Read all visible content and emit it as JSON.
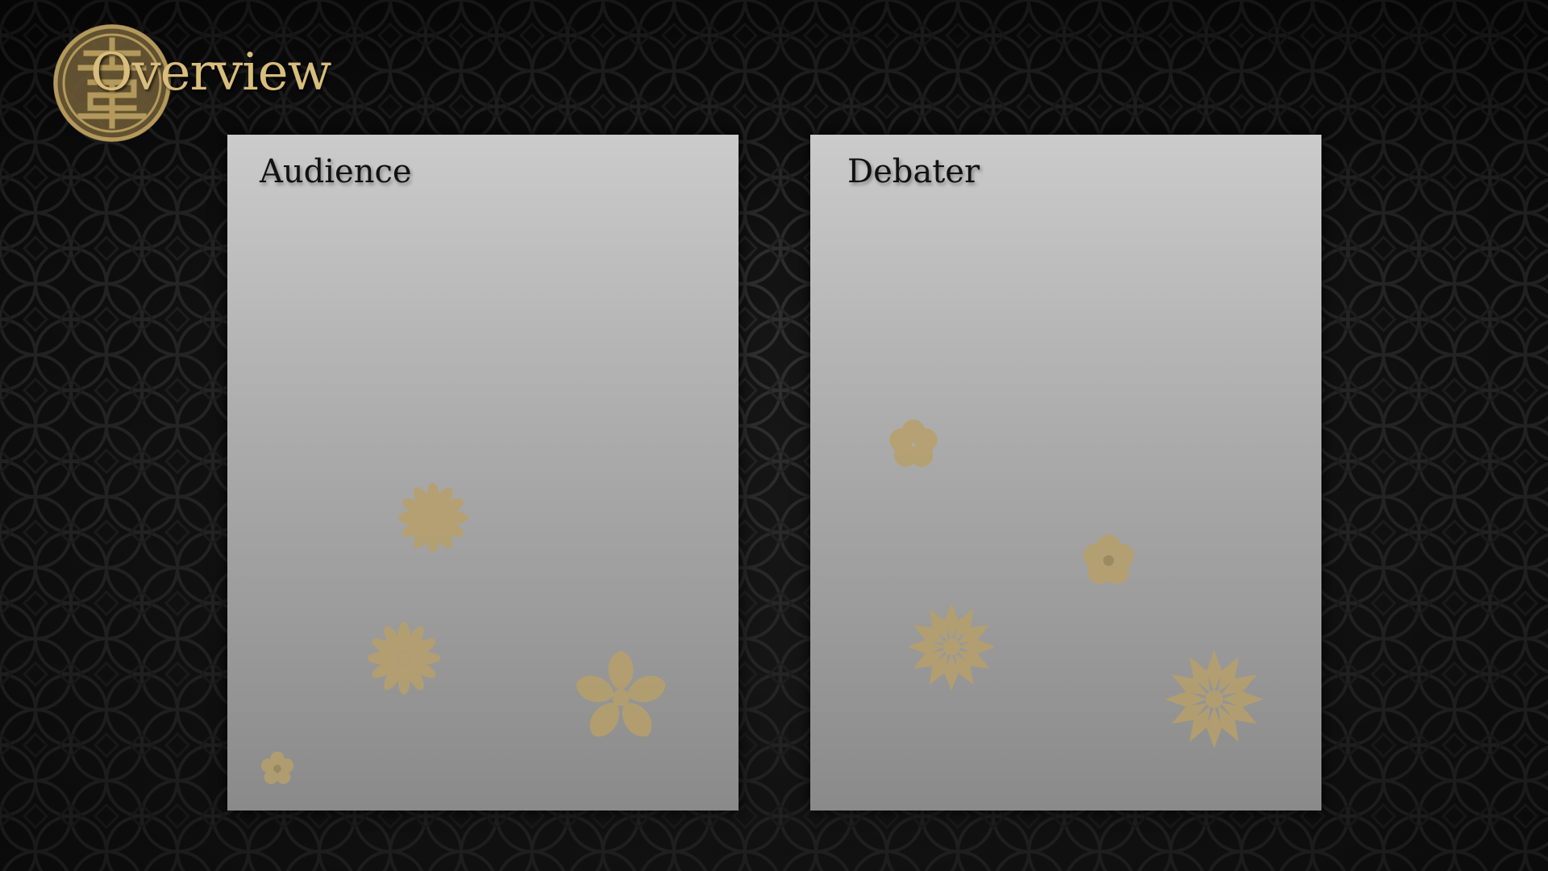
{
  "slide": {
    "title": "Overview",
    "emblem_icon": "shou-longevity-medallion-icon"
  },
  "panels": [
    {
      "label": "Audience",
      "decoration_icons": [
        "plum-blossom-icon",
        "chrysanthemum-icon",
        "cherry-blossom-icon",
        "small-flower-icon"
      ]
    },
    {
      "label": "Debater",
      "decoration_icons": [
        "plum-blossom-icon",
        "chrysanthemum-icon",
        "cherry-blossom-icon",
        "small-flower-icon"
      ]
    }
  ],
  "colors": {
    "background": "#141414",
    "pattern_line": "#2e2e2e",
    "title_gold": "#d9bd7c",
    "emblem_gold": "#b39a5c",
    "panel_top": "#cbcbcb",
    "panel_bottom": "#8a8a8a",
    "flower_gold": "#b7a06a",
    "label_text": "#111111"
  }
}
